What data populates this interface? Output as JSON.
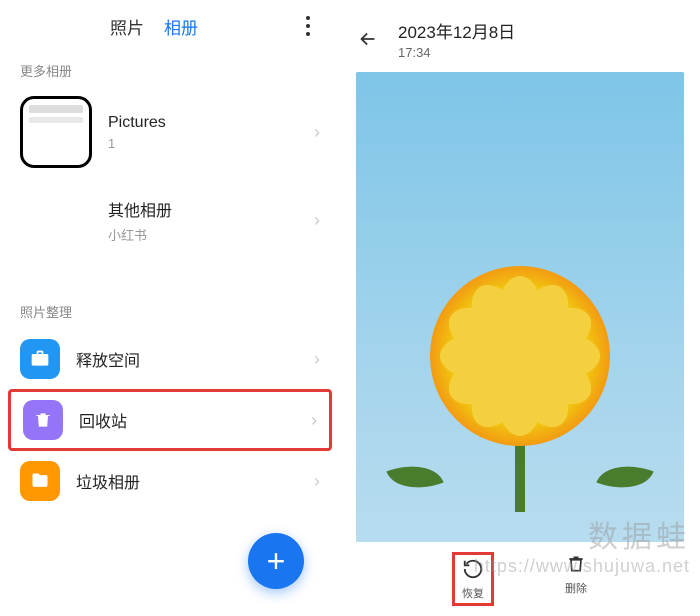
{
  "left": {
    "tabs": {
      "photos": "照片",
      "albums": "相册"
    },
    "sections": {
      "more_albums": "更多相册",
      "photo_org": "照片整理"
    },
    "albums": [
      {
        "title": "Pictures",
        "sub": "1"
      },
      {
        "title": "其他相册",
        "sub": "小红书"
      }
    ],
    "org": [
      {
        "title": "释放空间"
      },
      {
        "title": "回收站"
      },
      {
        "title": "垃圾相册"
      }
    ]
  },
  "right": {
    "date": "2023年12月8日",
    "time": "17:34",
    "actions": {
      "restore": "恢复",
      "delete": "删除"
    }
  },
  "watermark": {
    "title": "数据蛙",
    "url": "https://www.shujuwa.net"
  },
  "colors": {
    "accent": "#1976f0",
    "highlight": "#e53935"
  }
}
